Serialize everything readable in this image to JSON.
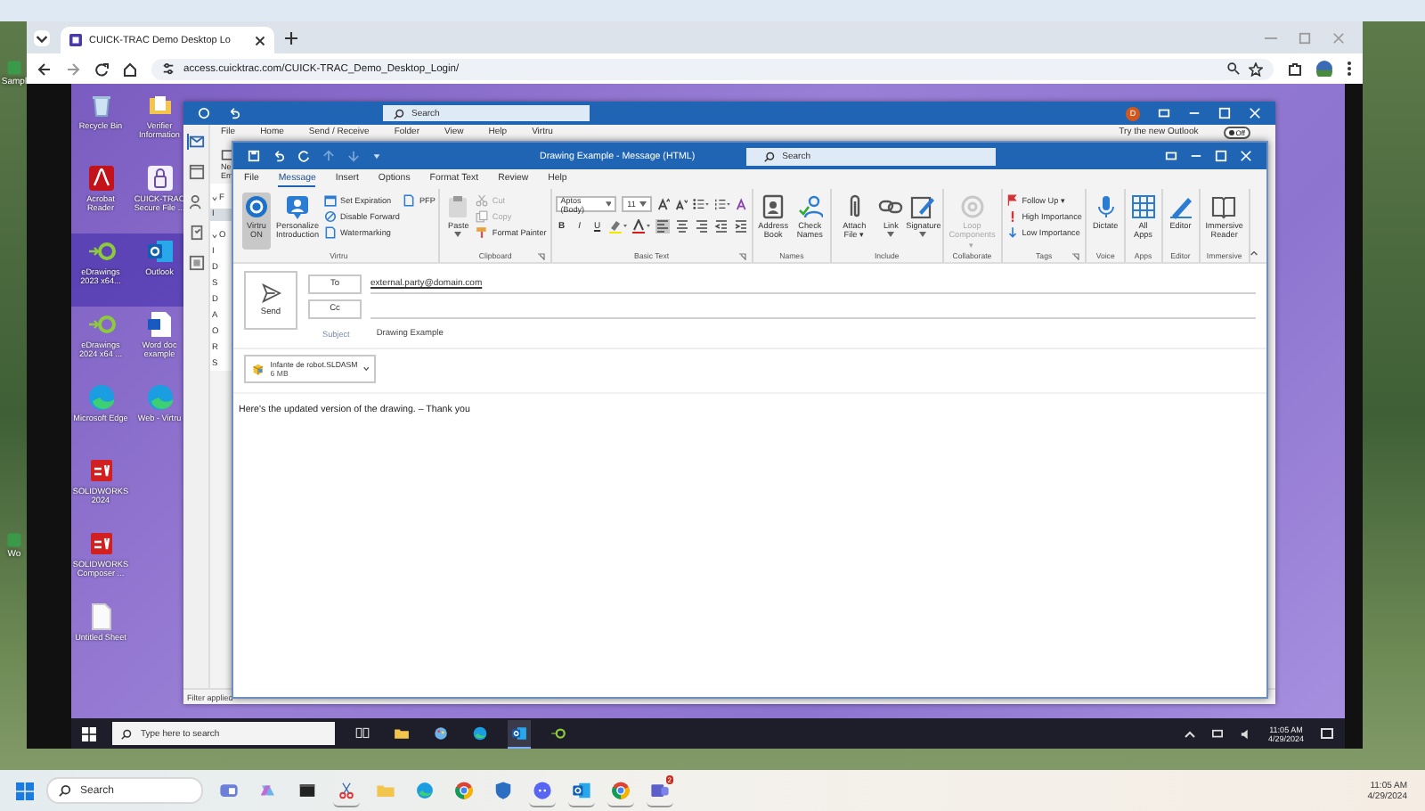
{
  "host_desktop": {
    "icons": [
      {
        "label": "Sampl",
        "kind": "app"
      },
      {
        "label": "Wo",
        "kind": "app"
      }
    ]
  },
  "browser": {
    "tab": {
      "title": "CUICK-TRAC Demo Desktop Lo",
      "selected": true
    },
    "address": "access.cuicktrac.com/CUICK-TRAC_Demo_Desktop_Login/"
  },
  "remote_desktop": {
    "icon_rows": [
      [
        {
          "label": "Recycle Bin",
          "kind": "recycle",
          "selected": false
        },
        {
          "label": "Verifier Information",
          "kind": "folder",
          "selected": false
        }
      ],
      [
        {
          "label": "Acrobat Reader",
          "kind": "pdf",
          "selected": false
        },
        {
          "label": "CUICK-TRAC Secure File ...",
          "kind": "lock",
          "selected": false
        }
      ],
      [
        {
          "label": "eDrawings 2023 x64...",
          "kind": "edrawings",
          "selected": true
        },
        {
          "label": "Outlook",
          "kind": "outlook",
          "selected": true
        }
      ],
      [
        {
          "label": "eDrawings 2024 x64 ...",
          "kind": "edrawings",
          "selected": false
        },
        {
          "label": "Word doc example",
          "kind": "word",
          "selected": false
        }
      ],
      [
        {
          "label": "Microsoft Edge",
          "kind": "edge",
          "selected": false
        },
        {
          "label": "Web - Virtru",
          "kind": "edge",
          "selected": false
        }
      ],
      [
        {
          "label": "SOLIDWORKS 2024",
          "kind": "solidworks",
          "selected": false
        }
      ],
      [
        {
          "label": "SOLIDWORKS Composer ...",
          "kind": "solidworks",
          "selected": false
        }
      ],
      [
        {
          "label": "Untitled Sheet",
          "kind": "file",
          "selected": false
        }
      ]
    ]
  },
  "outlook": {
    "search_placeholder": "Search",
    "avatar": "D",
    "menu": [
      "File",
      "Home",
      "Send / Receive",
      "Folder",
      "View",
      "Help",
      "Virtru"
    ],
    "try_new": "Try the new Outlook",
    "toggle": {
      "label": "Off",
      "on": false
    },
    "new_item": [
      "Ne",
      "Em"
    ],
    "folders": [
      {
        "label": "F",
        "kind": "header",
        "selected": false
      },
      {
        "label": "I",
        "kind": "item",
        "selected": true
      },
      {
        "label": "O",
        "kind": "header",
        "selected": false
      },
      {
        "label": "I",
        "kind": "item",
        "selected": false
      },
      {
        "label": "D",
        "kind": "item",
        "selected": false
      },
      {
        "label": "S",
        "kind": "item",
        "selected": false
      },
      {
        "label": "D",
        "kind": "item",
        "selected": false
      },
      {
        "label": "A",
        "kind": "item",
        "selected": false
      },
      {
        "label": "O",
        "kind": "item",
        "selected": false
      },
      {
        "label": "R",
        "kind": "item",
        "selected": false
      },
      {
        "label": "S",
        "kind": "item",
        "selected": false
      }
    ],
    "status": "Filter applied"
  },
  "compose": {
    "title": "Drawing Example  -  Message (HTML)",
    "search_placeholder": "Search",
    "tabs": [
      {
        "label": "File",
        "selected": false
      },
      {
        "label": "Message",
        "selected": true
      },
      {
        "label": "Insert",
        "selected": false
      },
      {
        "label": "Options",
        "selected": false
      },
      {
        "label": "Format Text",
        "selected": false
      },
      {
        "label": "Review",
        "selected": false
      },
      {
        "label": "Help",
        "selected": false
      }
    ],
    "ribbon": [
      {
        "name": "Virtru",
        "kind": "standard",
        "launcher": false,
        "buttons": [
          {
            "label": "Virtru ON",
            "kind": "virtru",
            "on": true,
            "disabled": false,
            "menu": false
          },
          {
            "label": "Personalize Introduction",
            "kind": "person",
            "on": false,
            "disabled": false,
            "menu": false
          }
        ],
        "options": [
          {
            "label": "Set Expiration",
            "kind": "calendar",
            "disabled": false,
            "menu": false
          },
          {
            "label": "Disable Forward",
            "kind": "block",
            "disabled": false,
            "menu": false
          },
          {
            "label": "Watermarking",
            "kind": "doc",
            "disabled": false,
            "menu": false
          },
          {
            "label": "PFP",
            "kind": "doc",
            "disabled": false,
            "menu": false
          }
        ]
      },
      {
        "name": "Clipboard",
        "kind": "standard",
        "launcher": true,
        "buttons": [
          {
            "label": "Paste",
            "kind": "paste",
            "on": false,
            "disabled": false,
            "menu": true
          }
        ],
        "options": [
          {
            "label": "Cut",
            "kind": "scissors",
            "disabled": true,
            "menu": false
          },
          {
            "label": "Copy",
            "kind": "copy",
            "disabled": true,
            "menu": false
          },
          {
            "label": "Format Painter",
            "kind": "brush",
            "disabled": false,
            "menu": false
          }
        ]
      },
      {
        "name": "Basic Text",
        "kind": "text_format",
        "launcher": true,
        "font": "Aptos (Body)",
        "size": "11",
        "styles": [
          "B",
          "I",
          "U"
        ]
      },
      {
        "name": "Names",
        "kind": "standard",
        "launcher": false,
        "buttons": [
          {
            "label": "Address Book",
            "kind": "book",
            "on": false,
            "disabled": false,
            "menu": false
          },
          {
            "label": "Check Names",
            "kind": "people",
            "on": false,
            "disabled": false,
            "menu": false
          }
        ]
      },
      {
        "name": "Include",
        "kind": "standard",
        "launcher": false,
        "buttons": [
          {
            "label": "Attach File ▾",
            "kind": "clip",
            "on": false,
            "disabled": false,
            "menu": false
          },
          {
            "label": "Link",
            "kind": "link",
            "on": false,
            "disabled": false,
            "menu": true
          },
          {
            "label": "Signature",
            "kind": "pen",
            "on": false,
            "disabled": false,
            "menu": true
          }
        ]
      },
      {
        "name": "Collaborate",
        "kind": "standard",
        "launcher": false,
        "buttons": [
          {
            "label": "Loop Components ▾",
            "kind": "loop",
            "on": false,
            "disabled": true,
            "menu": false
          }
        ]
      },
      {
        "name": "Tags",
        "kind": "standard",
        "launcher": true,
        "options": [
          {
            "label": "Follow Up ▾",
            "kind": "flag",
            "disabled": false,
            "menu": false
          },
          {
            "label": "High Importance",
            "kind": "exclaim",
            "disabled": false,
            "menu": false
          },
          {
            "label": "Low Importance",
            "kind": "down",
            "disabled": false,
            "menu": false
          }
        ]
      },
      {
        "name": "Voice",
        "kind": "standard",
        "launcher": false,
        "buttons": [
          {
            "label": "Dictate",
            "kind": "mic",
            "on": false,
            "disabled": false,
            "menu": false
          }
        ]
      },
      {
        "name": "Apps",
        "kind": "standard",
        "launcher": false,
        "buttons": [
          {
            "label": "All Apps",
            "kind": "grid",
            "on": false,
            "disabled": false,
            "menu": false
          }
        ]
      },
      {
        "name": "Editor",
        "kind": "standard",
        "launcher": false,
        "buttons": [
          {
            "label": "Editor",
            "kind": "editor",
            "on": false,
            "disabled": false,
            "menu": false
          }
        ]
      },
      {
        "name": "Immersive",
        "kind": "standard",
        "launcher": false,
        "buttons": [
          {
            "label": "Immersive Reader",
            "kind": "reader",
            "on": false,
            "disabled": false,
            "menu": false
          }
        ]
      }
    ],
    "send": "Send",
    "to_label": "To",
    "to_value": "external.party@domain.com",
    "cc_label": "Cc",
    "subject_label": "Subject",
    "subject_value": "Drawing Example",
    "attachment": {
      "name": "Infante de robot.SLDASM",
      "size": "6 MB"
    },
    "body": "Here's the updated version of the drawing. – Thank you"
  },
  "remote_taskbar": {
    "search_placeholder": "Type here to search",
    "apps": [
      {
        "kind": "taskview",
        "active": false
      },
      {
        "kind": "explorer",
        "active": false
      },
      {
        "kind": "paint",
        "active": false
      },
      {
        "kind": "edge",
        "active": false
      },
      {
        "kind": "outlook",
        "active": true
      },
      {
        "kind": "edrawings",
        "active": false
      }
    ],
    "time": "11:05 AM",
    "date": "4/29/2024"
  },
  "host_taskbar": {
    "search_placeholder": "Search",
    "apps": [
      {
        "kind": "widgets",
        "active": false
      },
      {
        "kind": "copilot",
        "active": false
      },
      {
        "kind": "terminal",
        "active": false
      },
      {
        "kind": "snip",
        "active": true
      },
      {
        "kind": "explorer",
        "active": false
      },
      {
        "kind": "edge",
        "active": false
      },
      {
        "kind": "chrome",
        "active": false
      },
      {
        "kind": "shield",
        "active": false
      },
      {
        "kind": "chat",
        "active": true
      },
      {
        "kind": "outlook",
        "active": true
      },
      {
        "kind": "chrome",
        "active": true
      },
      {
        "kind": "teams",
        "active": true,
        "badge": "2"
      }
    ],
    "time": "11:05 AM",
    "date": "4/29/2024"
  }
}
